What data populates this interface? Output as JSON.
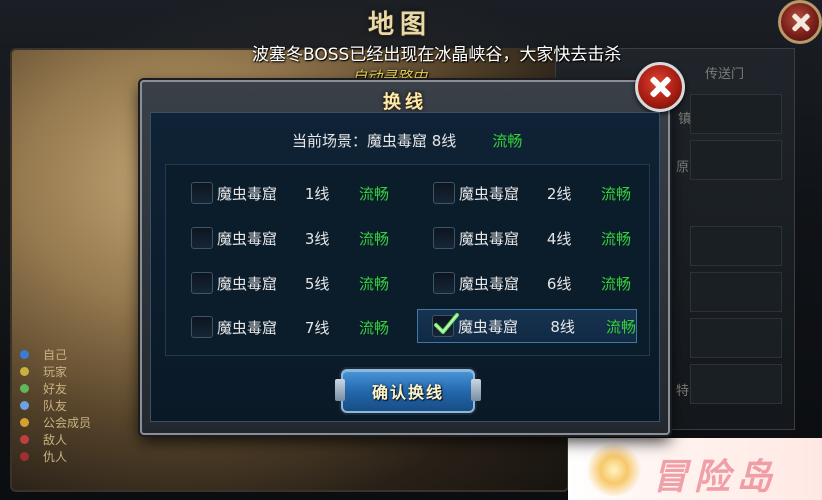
{
  "background": {
    "title": "地图",
    "legend": [
      {
        "label": "自己",
        "color": "#3a7bd5"
      },
      {
        "label": "玩家",
        "color": "#c9b040"
      },
      {
        "label": "好友",
        "color": "#5fb85a"
      },
      {
        "label": "队友",
        "color": "#6fa0e0"
      },
      {
        "label": "公会成员",
        "color": "#d4a030"
      },
      {
        "label": "敌人",
        "color": "#c04040"
      },
      {
        "label": "仇人",
        "color": "#a03030"
      }
    ],
    "right_fragments": [
      "传送门",
      "镇",
      "原",
      "特"
    ]
  },
  "announcement": "波塞冬BOSS已经出现在冰晶峡谷，大家快去击杀",
  "auto_path": "自动寻路中...",
  "dialog": {
    "title": "换线",
    "current_label": "当前场景：魔虫毒窟 8线",
    "current_status": "流畅",
    "lines": [
      {
        "name": "魔虫毒窟",
        "num": "1线",
        "status": "流畅",
        "checked": false
      },
      {
        "name": "魔虫毒窟",
        "num": "2线",
        "status": "流畅",
        "checked": false
      },
      {
        "name": "魔虫毒窟",
        "num": "3线",
        "status": "流畅",
        "checked": false
      },
      {
        "name": "魔虫毒窟",
        "num": "4线",
        "status": "流畅",
        "checked": false
      },
      {
        "name": "魔虫毒窟",
        "num": "5线",
        "status": "流畅",
        "checked": false
      },
      {
        "name": "魔虫毒窟",
        "num": "6线",
        "status": "流畅",
        "checked": false
      },
      {
        "name": "魔虫毒窟",
        "num": "7线",
        "status": "流畅",
        "checked": false
      },
      {
        "name": "魔虫毒窟",
        "num": "8线",
        "status": "流畅",
        "checked": true
      }
    ],
    "confirm_label": "确认换线"
  },
  "watermark": "冒险岛",
  "colors": {
    "status_green": "#35d13a",
    "title_gold": "#ffe9a8",
    "button_blue": "#2468ad"
  }
}
